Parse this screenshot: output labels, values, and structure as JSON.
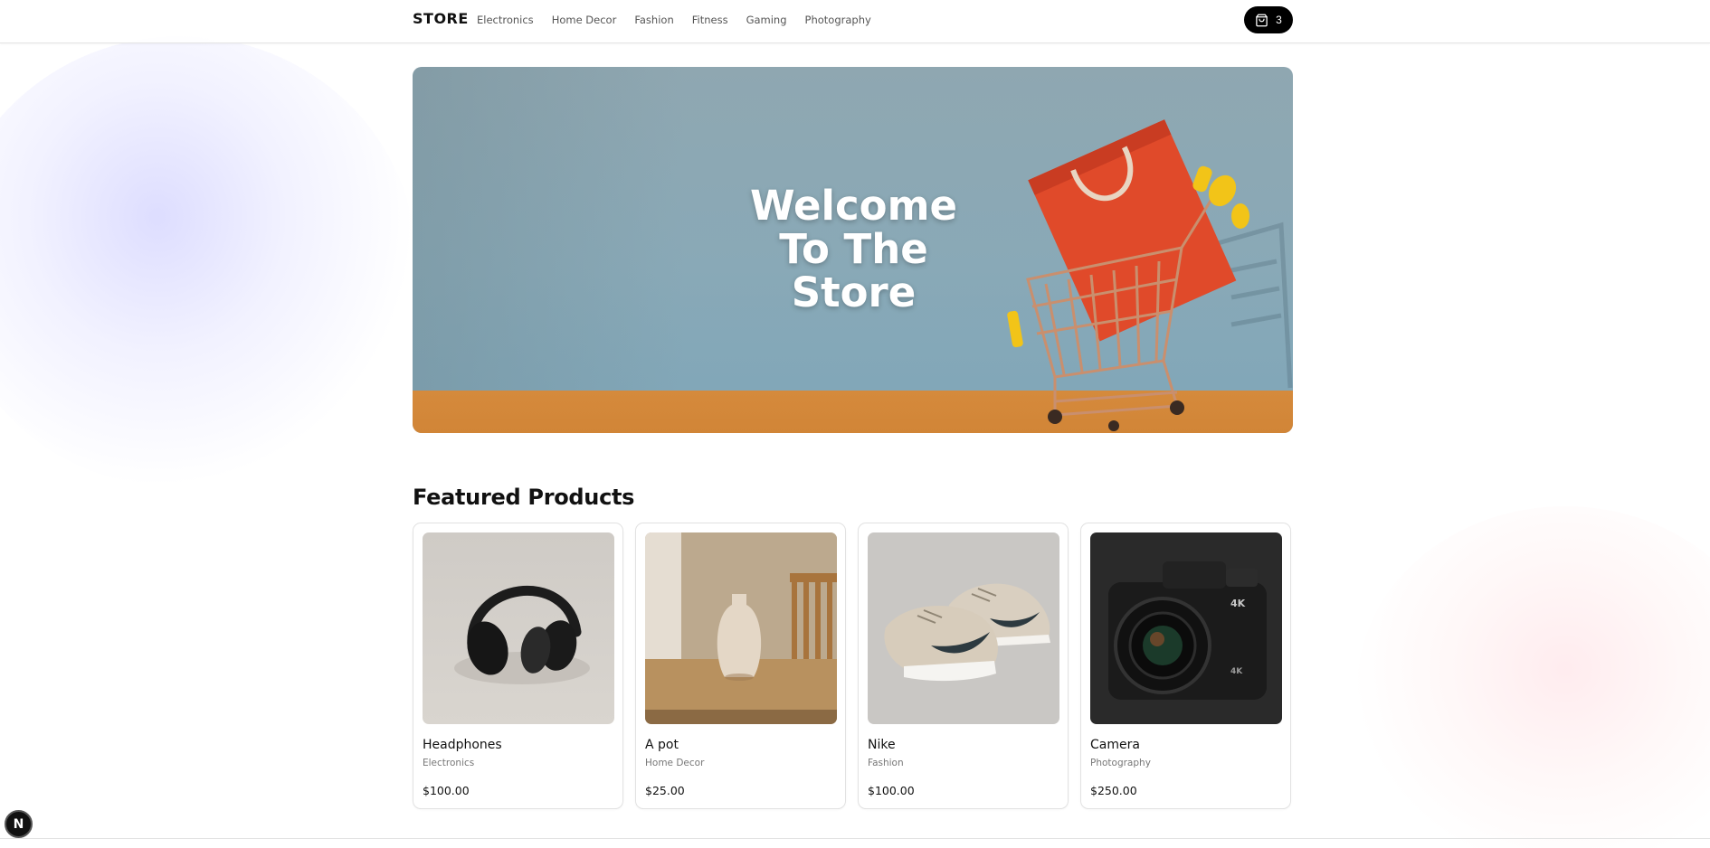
{
  "header": {
    "logo": "STORE",
    "nav": [
      "Electronics",
      "Home Decor",
      "Fashion",
      "Fitness",
      "Gaming",
      "Photography"
    ],
    "cart": {
      "icon": "cart-icon",
      "count": "3"
    }
  },
  "hero": {
    "title": "Welcome\nTo The\nStore"
  },
  "featured": {
    "title": "Featured Products",
    "products": [
      {
        "name": "Headphones",
        "category": "Electronics",
        "price": "$100.00"
      },
      {
        "name": "A pot",
        "category": "Home Decor",
        "price": "$25.00"
      },
      {
        "name": "Nike",
        "category": "Fashion",
        "price": "$100.00"
      },
      {
        "name": "Camera",
        "category": "Photography",
        "price": "$250.00"
      }
    ]
  },
  "dev_badge": {
    "label": "N"
  },
  "colors": {
    "accent": "#000000",
    "hero_sky": "#89a9b7",
    "hero_floor": "#d58a3c",
    "bag": "#e04a2a"
  }
}
